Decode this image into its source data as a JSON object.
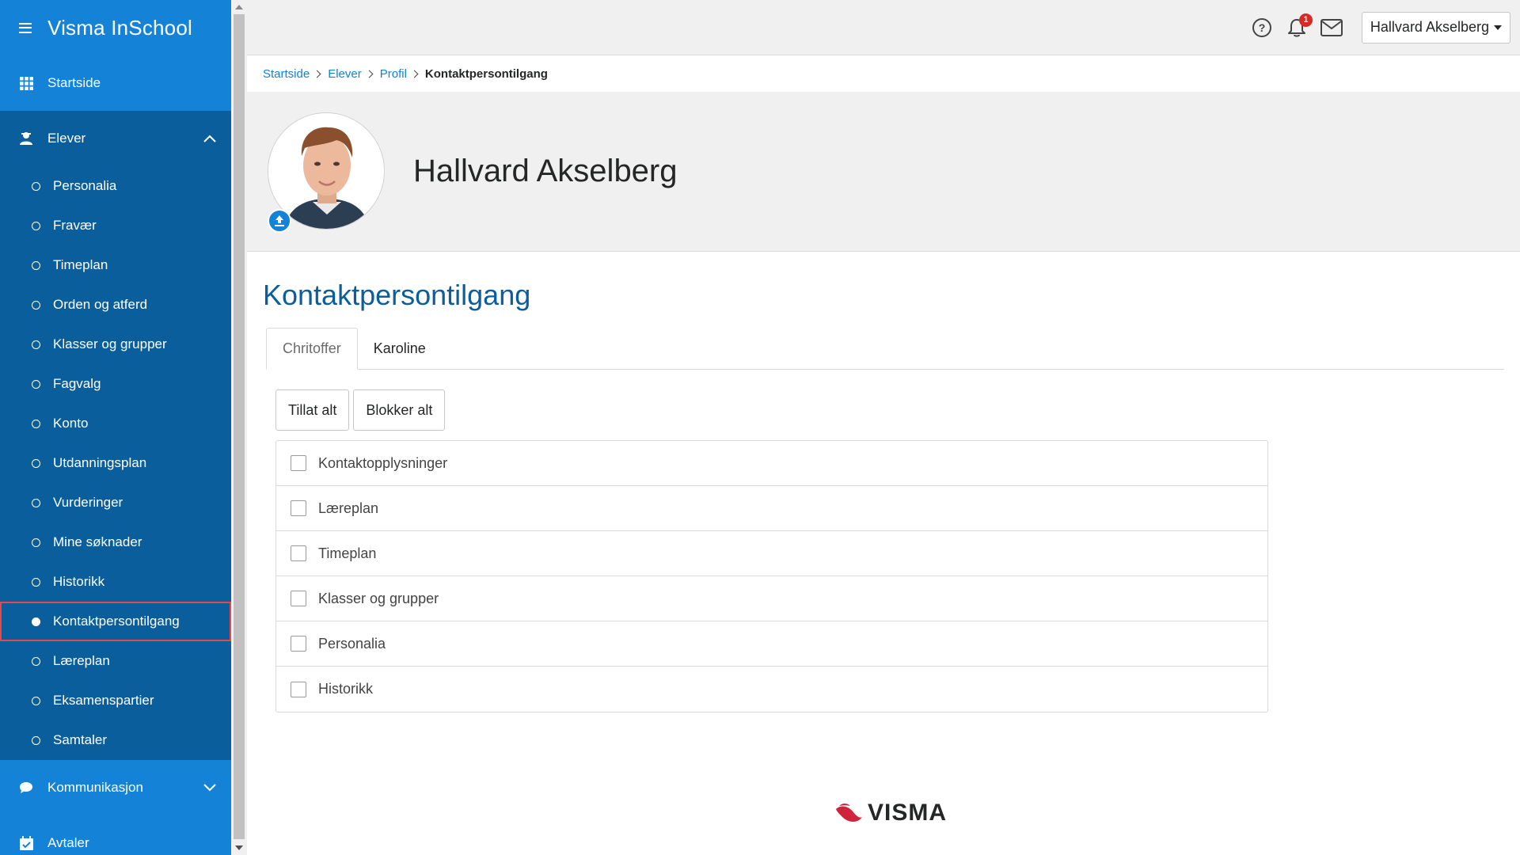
{
  "app": {
    "title": "Visma InSchool"
  },
  "sidebar": {
    "home": "Startside",
    "section": "Elever",
    "items": [
      {
        "label": "Personalia",
        "active": false
      },
      {
        "label": "Fravær",
        "active": false
      },
      {
        "label": "Timeplan",
        "active": false
      },
      {
        "label": "Orden og atferd",
        "active": false
      },
      {
        "label": "Klasser og grupper",
        "active": false
      },
      {
        "label": "Fagvalg",
        "active": false
      },
      {
        "label": "Konto",
        "active": false
      },
      {
        "label": "Utdanningsplan",
        "active": false
      },
      {
        "label": "Vurderinger",
        "active": false
      },
      {
        "label": "Mine søknader",
        "active": false
      },
      {
        "label": "Historikk",
        "active": false
      },
      {
        "label": "Kontaktpersontilgang",
        "active": true
      },
      {
        "label": "Læreplan",
        "active": false
      },
      {
        "label": "Eksamenspartier",
        "active": false
      },
      {
        "label": "Samtaler",
        "active": false
      }
    ],
    "bottom": [
      "Kommunikasjon",
      "Avtaler"
    ]
  },
  "topbar": {
    "notification_count": "1",
    "user_name": "Hallvard Akselberg",
    "icons": [
      "help-icon",
      "bell-icon",
      "mail-icon"
    ]
  },
  "breadcrumb": {
    "items": [
      "Startside",
      "Elever",
      "Profil"
    ],
    "current": "Kontaktpersontilgang"
  },
  "profile": {
    "name": "Hallvard Akselberg"
  },
  "page": {
    "title": "Kontaktpersontilgang",
    "tabs": [
      {
        "label": "Chritoffer",
        "active": true
      },
      {
        "label": "Karoline",
        "active": false
      }
    ],
    "allow_all": "Tillat alt",
    "block_all": "Blokker alt",
    "permissions": [
      {
        "label": "Kontaktopplysninger",
        "checked": false
      },
      {
        "label": "Læreplan",
        "checked": false
      },
      {
        "label": "Timeplan",
        "checked": false
      },
      {
        "label": "Klasser og grupper",
        "checked": false
      },
      {
        "label": "Personalia",
        "checked": false
      },
      {
        "label": "Historikk",
        "checked": false
      }
    ]
  },
  "footer": {
    "logo": "VISMA"
  },
  "colors": {
    "sidebar_dark": "#0a5e9b",
    "sidebar_light": "#1482d6",
    "accent": "#1482d6",
    "highlight_outline": "#e5484d",
    "logo_red": "#d0233c"
  }
}
